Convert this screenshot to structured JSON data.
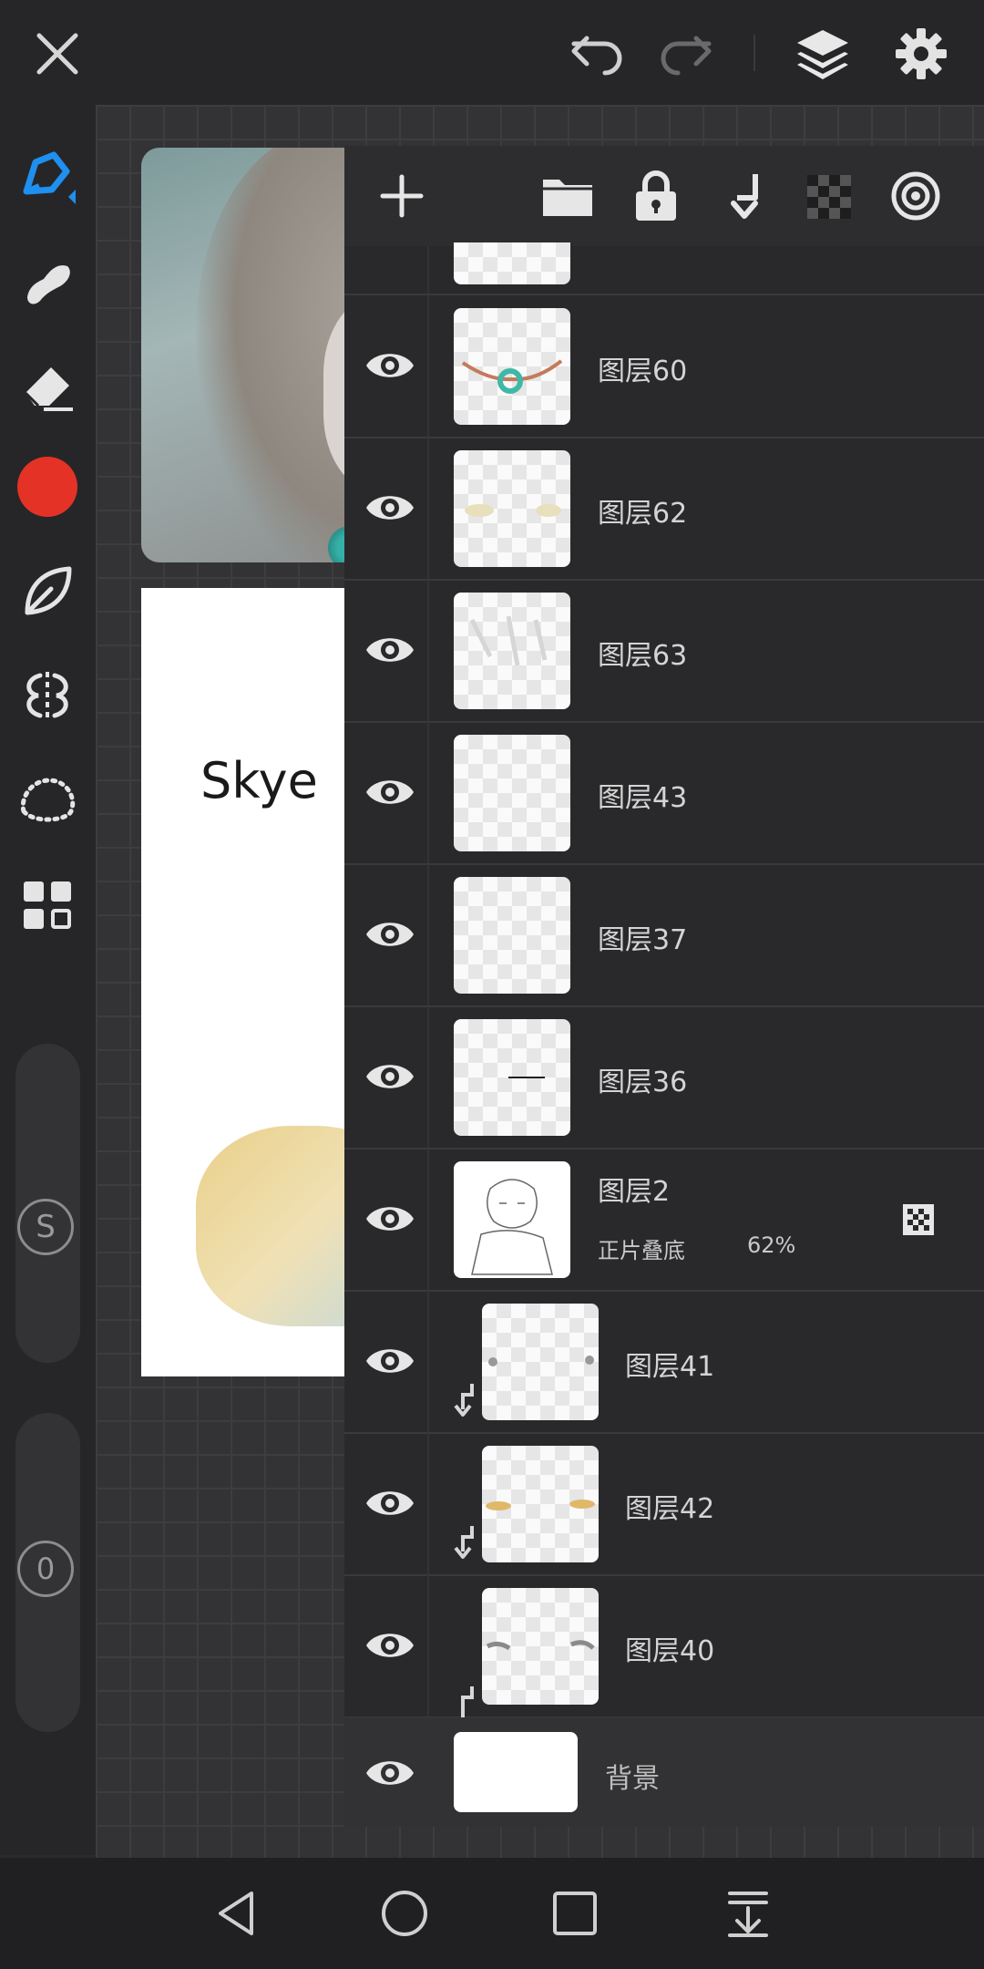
{
  "top_toolbar": {
    "close_icon": "close-icon",
    "undo_icon": "undo-icon",
    "redo_icon": "redo-icon",
    "layers_icon": "layers-icon",
    "settings_icon": "gear-icon"
  },
  "tool_sidebar": {
    "tools": [
      "pen-tool-icon",
      "smudge-icon",
      "eraser-icon",
      "color-swatch",
      "leaf-brush-icon",
      "symmetry-icon",
      "lasso-select-icon",
      "grid-tools-icon"
    ],
    "active_color": "#e53226",
    "brush_size_label": "S",
    "opacity_label": "0"
  },
  "canvas": {
    "signature_text": "Skye"
  },
  "layers_panel": {
    "toolbar_icons": [
      "add-layer-icon",
      "folder-icon",
      "lock-icon",
      "merge-down-icon",
      "alpha-lock-icon",
      "layer-mask-icon"
    ],
    "layers": [
      {
        "name": "图层60"
      },
      {
        "name": "图层62"
      },
      {
        "name": "图层63"
      },
      {
        "name": "图层43"
      },
      {
        "name": "图层37"
      },
      {
        "name": "图层36"
      },
      {
        "name": "图层2",
        "blend": "正片叠底",
        "opacity": "62%"
      },
      {
        "name": "图层41"
      },
      {
        "name": "图层42"
      },
      {
        "name": "图层40"
      },
      {
        "name": "背景"
      }
    ]
  },
  "nav_bar": {
    "buttons": [
      "back-icon",
      "home-icon",
      "recents-icon",
      "notification-pull-icon"
    ]
  }
}
